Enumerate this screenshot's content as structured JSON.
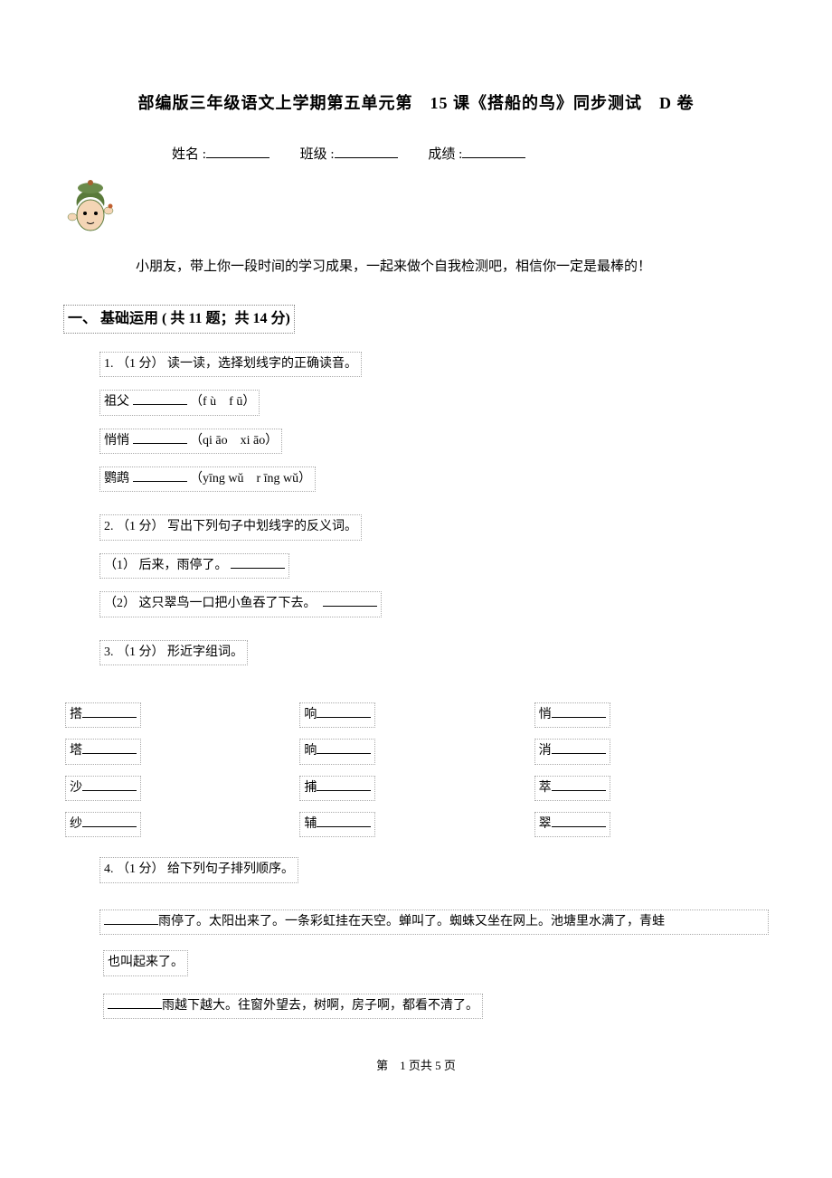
{
  "title": "部编版三年级语文上学期第五单元第　15 课《搭船的鸟》同步测试　D 卷",
  "fillLine": {
    "nameLabel": "姓名 :",
    "classLabel": "班级 :",
    "scoreLabel": "成绩 :"
  },
  "greeting": "小朋友，带上你一段时间的学习成果，一起来做个自我检测吧，相信你一定是最棒的！",
  "section1": {
    "header": "一、 基础运用 ( 共 11 题；共 14 分)",
    "q1": {
      "label": "1. （1 分） 读一读，选择划线字的正确读音。",
      "line1a": "祖父",
      "line1b": "（f ù　f ū）",
      "line2a": "悄悄",
      "line2b": "（qi āo　xi āo）",
      "line3a": "鹦鹉",
      "line3b": "（yīng wǔ　r īng wǔ）"
    },
    "q2": {
      "label": "2. （1 分） 写出下列句子中划线字的反义词。",
      "line1": "（1） 后来，雨停了。",
      "line2": "（2） 这只翠鸟一口把小鱼吞了下去。"
    },
    "q3": {
      "label": "3. （1 分） 形近字组词。",
      "row1": {
        "c1": "搭",
        "c2": "响",
        "c3": "悄"
      },
      "row2": {
        "c1": "塔",
        "c2": "晌",
        "c3": "消"
      },
      "row3": {
        "c1": "沙",
        "c2": "捕",
        "c3": "萃"
      },
      "row4": {
        "c1": "纱",
        "c2": "辅",
        "c3": "翠"
      }
    },
    "q4": {
      "label": "4. （1 分） 给下列句子排列顺序。",
      "p1": "雨停了。太阳出来了。一条彩虹挂在天空。蝉叫了。蜘蛛又坐在网上。池塘里水满了，青蛙",
      "p1b": "也叫起来了。",
      "p2": "雨越下越大。往窗外望去，树啊，房子啊，都看不清了。"
    }
  },
  "pageNum": "第　1 页共 5 页"
}
